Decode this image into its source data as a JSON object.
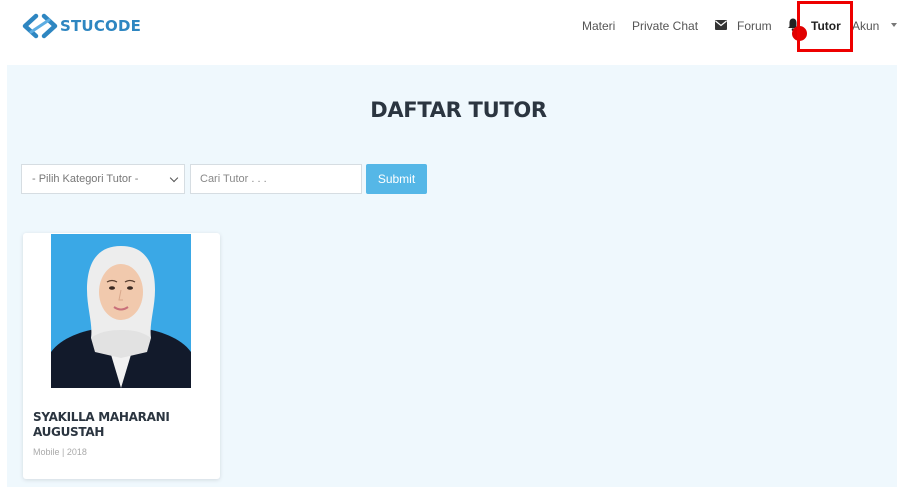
{
  "brand": {
    "name": "STUCODE",
    "logo_icon": "stucode-chevrons-icon",
    "color": "#2e86c1"
  },
  "nav": {
    "items": [
      {
        "label": "Materi"
      },
      {
        "label": "Private Chat"
      },
      {
        "label": "Forum",
        "icon": "envelope-icon"
      },
      {
        "label": "Tutor",
        "icon": "bell-icon",
        "active": true,
        "has_notification": true
      },
      {
        "label": "Akun",
        "icon": "caret-down-icon"
      }
    ],
    "highlight_color": "#ee0000"
  },
  "page": {
    "title": "DAFTAR TUTOR",
    "background": "#eff8fd"
  },
  "filters": {
    "category_select": {
      "selected": "- Pilih Kategori Tutor -"
    },
    "search": {
      "placeholder": "Cari Tutor . . ."
    },
    "submit_label": "Submit",
    "submit_color": "#55b7e7"
  },
  "tutors": [
    {
      "name": "SYAKILLA MAHARANI AUGUSTAH",
      "meta": "Mobile | 2018",
      "photo_background": "#3aa8e6"
    }
  ]
}
